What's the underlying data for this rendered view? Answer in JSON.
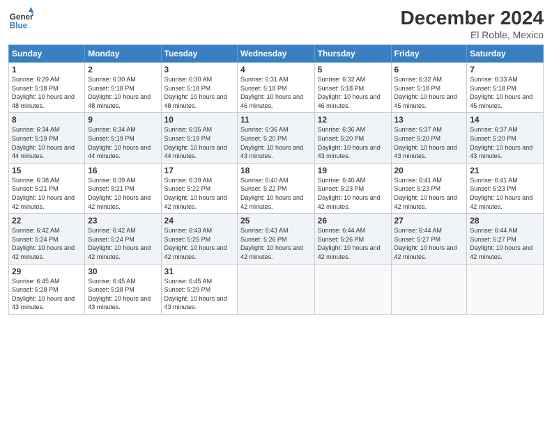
{
  "logo": {
    "line1": "General",
    "line2": "Blue"
  },
  "title": "December 2024",
  "location": "El Roble, Mexico",
  "days_of_week": [
    "Sunday",
    "Monday",
    "Tuesday",
    "Wednesday",
    "Thursday",
    "Friday",
    "Saturday"
  ],
  "weeks": [
    [
      {
        "day": "1",
        "sunrise": "6:29 AM",
        "sunset": "5:18 PM",
        "daylight": "10 hours and 48 minutes."
      },
      {
        "day": "2",
        "sunrise": "6:30 AM",
        "sunset": "5:18 PM",
        "daylight": "10 hours and 48 minutes."
      },
      {
        "day": "3",
        "sunrise": "6:30 AM",
        "sunset": "5:18 PM",
        "daylight": "10 hours and 48 minutes."
      },
      {
        "day": "4",
        "sunrise": "6:31 AM",
        "sunset": "5:18 PM",
        "daylight": "10 hours and 46 minutes."
      },
      {
        "day": "5",
        "sunrise": "6:32 AM",
        "sunset": "5:18 PM",
        "daylight": "10 hours and 46 minutes."
      },
      {
        "day": "6",
        "sunrise": "6:32 AM",
        "sunset": "5:18 PM",
        "daylight": "10 hours and 45 minutes."
      },
      {
        "day": "7",
        "sunrise": "6:33 AM",
        "sunset": "5:18 PM",
        "daylight": "10 hours and 45 minutes."
      }
    ],
    [
      {
        "day": "8",
        "sunrise": "6:34 AM",
        "sunset": "5:19 PM",
        "daylight": "10 hours and 44 minutes."
      },
      {
        "day": "9",
        "sunrise": "6:34 AM",
        "sunset": "5:19 PM",
        "daylight": "10 hours and 44 minutes."
      },
      {
        "day": "10",
        "sunrise": "6:35 AM",
        "sunset": "5:19 PM",
        "daylight": "10 hours and 44 minutes."
      },
      {
        "day": "11",
        "sunrise": "6:36 AM",
        "sunset": "5:20 PM",
        "daylight": "10 hours and 43 minutes."
      },
      {
        "day": "12",
        "sunrise": "6:36 AM",
        "sunset": "5:20 PM",
        "daylight": "10 hours and 43 minutes."
      },
      {
        "day": "13",
        "sunrise": "6:37 AM",
        "sunset": "5:20 PM",
        "daylight": "10 hours and 43 minutes."
      },
      {
        "day": "14",
        "sunrise": "6:37 AM",
        "sunset": "5:20 PM",
        "daylight": "10 hours and 43 minutes."
      }
    ],
    [
      {
        "day": "15",
        "sunrise": "6:38 AM",
        "sunset": "5:21 PM",
        "daylight": "10 hours and 42 minutes."
      },
      {
        "day": "16",
        "sunrise": "6:39 AM",
        "sunset": "5:21 PM",
        "daylight": "10 hours and 42 minutes."
      },
      {
        "day": "17",
        "sunrise": "6:39 AM",
        "sunset": "5:22 PM",
        "daylight": "10 hours and 42 minutes."
      },
      {
        "day": "18",
        "sunrise": "6:40 AM",
        "sunset": "5:22 PM",
        "daylight": "10 hours and 42 minutes."
      },
      {
        "day": "19",
        "sunrise": "6:40 AM",
        "sunset": "5:23 PM",
        "daylight": "10 hours and 42 minutes."
      },
      {
        "day": "20",
        "sunrise": "6:41 AM",
        "sunset": "5:23 PM",
        "daylight": "10 hours and 42 minutes."
      },
      {
        "day": "21",
        "sunrise": "6:41 AM",
        "sunset": "5:23 PM",
        "daylight": "10 hours and 42 minutes."
      }
    ],
    [
      {
        "day": "22",
        "sunrise": "6:42 AM",
        "sunset": "5:24 PM",
        "daylight": "10 hours and 42 minutes."
      },
      {
        "day": "23",
        "sunrise": "6:42 AM",
        "sunset": "5:24 PM",
        "daylight": "10 hours and 42 minutes."
      },
      {
        "day": "24",
        "sunrise": "6:43 AM",
        "sunset": "5:25 PM",
        "daylight": "10 hours and 42 minutes."
      },
      {
        "day": "25",
        "sunrise": "6:43 AM",
        "sunset": "5:26 PM",
        "daylight": "10 hours and 42 minutes."
      },
      {
        "day": "26",
        "sunrise": "6:44 AM",
        "sunset": "5:26 PM",
        "daylight": "10 hours and 42 minutes."
      },
      {
        "day": "27",
        "sunrise": "6:44 AM",
        "sunset": "5:27 PM",
        "daylight": "10 hours and 42 minutes."
      },
      {
        "day": "28",
        "sunrise": "6:44 AM",
        "sunset": "5:27 PM",
        "daylight": "10 hours and 42 minutes."
      }
    ],
    [
      {
        "day": "29",
        "sunrise": "6:45 AM",
        "sunset": "5:28 PM",
        "daylight": "10 hours and 43 minutes."
      },
      {
        "day": "30",
        "sunrise": "6:45 AM",
        "sunset": "5:28 PM",
        "daylight": "10 hours and 43 minutes."
      },
      {
        "day": "31",
        "sunrise": "6:45 AM",
        "sunset": "5:29 PM",
        "daylight": "10 hours and 43 minutes."
      },
      null,
      null,
      null,
      null
    ]
  ]
}
